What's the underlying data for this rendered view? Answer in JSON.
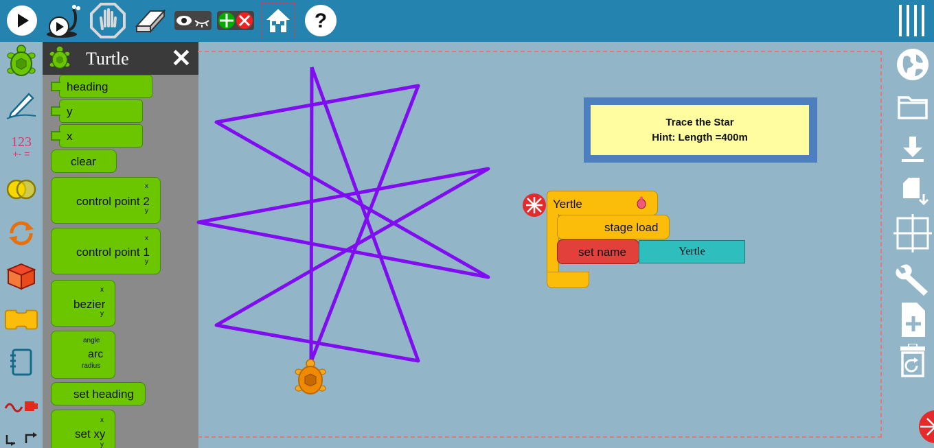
{
  "toolbar": {
    "icons": [
      "play-icon",
      "slow-run-icon",
      "stop-icon",
      "eraser-icon",
      "hide-blocks-icon",
      "collapse-expand-icon",
      "home-icon",
      "help-icon",
      "main-menu-icon"
    ]
  },
  "palette": {
    "items": [
      "turtle-palette-icon",
      "pen-palette-icon",
      "number-palette-icon",
      "boolean-palette-icon",
      "flow-palette-icon",
      "box-palette-icon",
      "action-palette-icon",
      "media-palette-icon",
      "sensors-palette-icon",
      "extras-palette-icon"
    ],
    "number_label": "123"
  },
  "flyout": {
    "title": "Turtle",
    "close_label": "✕",
    "blocks": {
      "heading": "heading",
      "y": "y",
      "x": "x",
      "clear": "clear",
      "control_point_2": "control point 2",
      "control_point_1": "control point 1",
      "bezier": "bezier",
      "arc": "arc",
      "set_heading": "set heading",
      "set_xy": "set xy"
    },
    "args": {
      "x": "x",
      "y": "y",
      "angle": "angle",
      "radius": "radius"
    }
  },
  "hint": {
    "line1": "Trace the Star",
    "line2": "Hint: Length =400m"
  },
  "program": {
    "start_label": "Yertle",
    "stage_load_label": "stage load",
    "set_name_label": "set name",
    "name_value": "Yertle"
  },
  "colors": {
    "toolbar": "#2584af",
    "canvas": "#92b5c8",
    "turtle_block": "#6bc600",
    "star_line": "#7f0df0",
    "start_block": "#fcbc0a",
    "set_name_block": "#e2403a",
    "text_value": "#2ebebe",
    "hint_bg": "#fffda0"
  }
}
